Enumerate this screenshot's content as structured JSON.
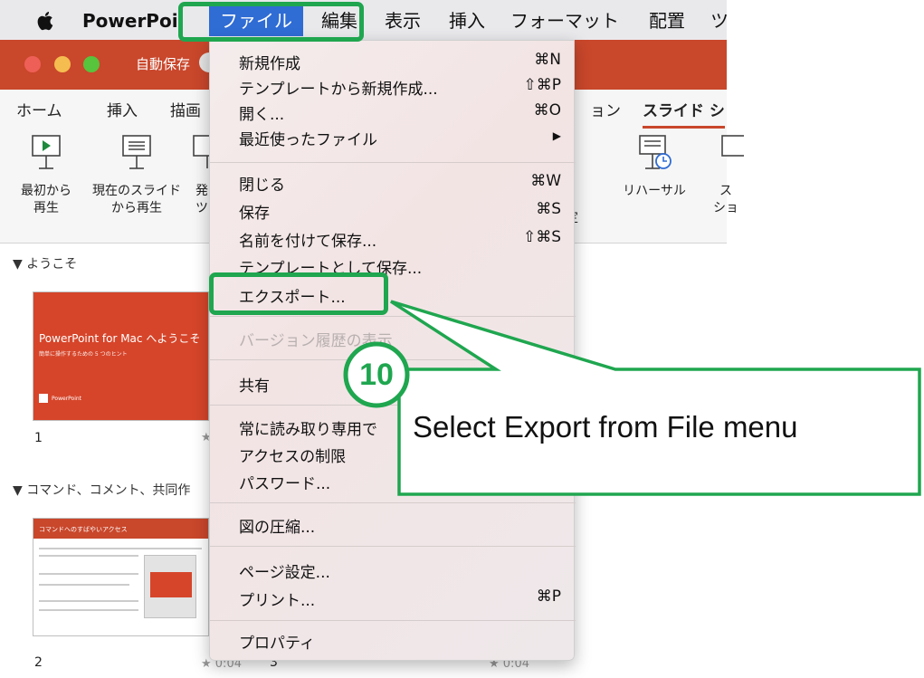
{
  "menubar": {
    "app_name": "PowerPoi",
    "file": "ファイル",
    "edit": "編集",
    "view": "表示",
    "insert": "挿入",
    "format": "フォーマット",
    "arrange": "配置",
    "tools": "ツ"
  },
  "titlebar": {
    "autosave": "自動保存"
  },
  "ribbon": {
    "tabs": {
      "home": "ホーム",
      "insert": "挿入",
      "draw": "描画",
      "transitions": "ョン",
      "slideshow": "スライド シ"
    },
    "buttons": {
      "from_beginning_1": "最初から",
      "from_beginning_2": "再生",
      "from_current_1": "現在のスライド",
      "from_current_2": "から再生",
      "present_1": "発",
      "present_2": "ツ",
      "rehearse": "リハーサル",
      "more_1": "ス",
      "more_2": "ショ",
      "settings_fragment": "定"
    }
  },
  "slides_panel": {
    "section_welcome": "▼ ようこそ",
    "section_command": "▼ コマンド、コメント、共同作",
    "slide1": {
      "title": "PowerPoint for Mac へようこそ",
      "subtitle": "簡単に操作するための 5 つのヒント",
      "logo": "PowerPoint",
      "number": "1",
      "time": "★"
    },
    "slide2": {
      "title": "コマンドへのすばやいアクセス",
      "number": "2",
      "time": "★ 0:04"
    },
    "slide3": {
      "number": "3",
      "time": "★ 0:04"
    }
  },
  "file_menu": {
    "items": [
      {
        "label": "新規作成",
        "shortcut": "⌘N"
      },
      {
        "label": "テンプレートから新規作成...",
        "shortcut": "⇧⌘P"
      },
      {
        "label": "開く...",
        "shortcut": "⌘O"
      },
      {
        "label": "最近使ったファイル",
        "shortcut": "▶"
      },
      {
        "label": "閉じる",
        "shortcut": "⌘W"
      },
      {
        "label": "保存",
        "shortcut": "⌘S"
      },
      {
        "label": "名前を付けて保存...",
        "shortcut": "⇧⌘S"
      },
      {
        "label": "テンプレートとして保存...",
        "shortcut": ""
      },
      {
        "label": "エクスポート...",
        "shortcut": ""
      },
      {
        "label": "バージョン履歴の表示",
        "shortcut": ""
      },
      {
        "label": "共有",
        "shortcut": ""
      },
      {
        "label": "常に読み取り専用で",
        "shortcut": ""
      },
      {
        "label": "アクセスの制限",
        "shortcut": ""
      },
      {
        "label": "パスワード...",
        "shortcut": ""
      },
      {
        "label": "図の圧縮...",
        "shortcut": ""
      },
      {
        "label": "ページ設定...",
        "shortcut": ""
      },
      {
        "label": "プリント...",
        "shortcut": "⌘P"
      },
      {
        "label": "プロパティ",
        "shortcut": ""
      }
    ]
  },
  "annotation": {
    "step_number": "10",
    "callout_text": "Select Export from File menu",
    "accent_color": "#1fa64f"
  },
  "colors": {
    "title_bar": "#c9472b",
    "menu_highlight": "#2f6cd4"
  }
}
